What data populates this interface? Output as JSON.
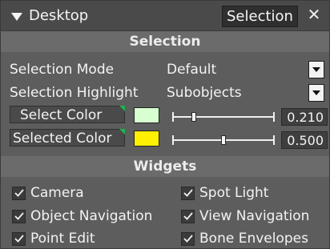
{
  "titlebar": {
    "title": "Desktop",
    "tab_label": "Selection",
    "close_glyph": "✕"
  },
  "sections": {
    "selection": {
      "header": "Selection"
    },
    "widgets": {
      "header": "Widgets"
    }
  },
  "selection": {
    "mode": {
      "label": "Selection Mode",
      "value": "Default"
    },
    "highlight": {
      "label": "Selection Highlight",
      "value": "Subobjects"
    },
    "select_color": {
      "label": "Select Color",
      "color": "#d8ffd0",
      "value": "0.210",
      "fraction": 0.21
    },
    "selected_color": {
      "label": "Selected Color",
      "color": "#ffef00",
      "value": "0.500",
      "fraction": 0.5
    }
  },
  "widgets": {
    "items": [
      {
        "label": "Camera",
        "checked": true
      },
      {
        "label": "Spot Light",
        "checked": true
      },
      {
        "label": "Object Navigation",
        "checked": true
      },
      {
        "label": "View Navigation",
        "checked": true
      },
      {
        "label": "Point Edit",
        "checked": true
      },
      {
        "label": "Bone Envelopes",
        "checked": true
      }
    ]
  },
  "colors": {
    "background": "#5d5d5d",
    "accent_green": "#1bb54a"
  },
  "icons": {
    "title_arrow": "triangle-down-icon",
    "dropdown": "chevron-down-icon",
    "check": "checkmark-icon",
    "close": "close-icon"
  }
}
